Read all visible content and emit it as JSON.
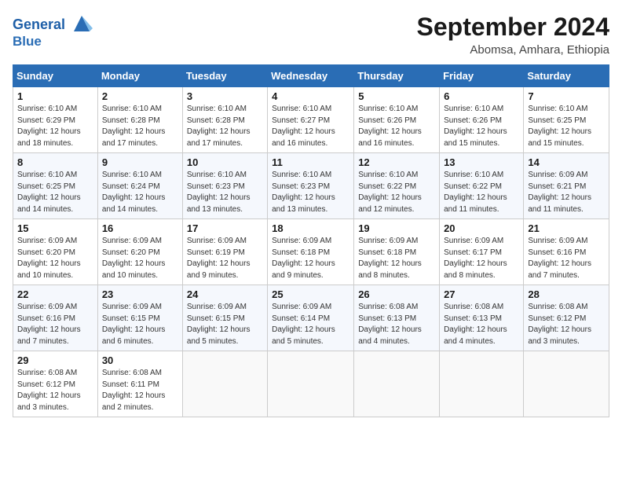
{
  "header": {
    "logo_line1": "General",
    "logo_line2": "Blue",
    "month": "September 2024",
    "location": "Abomsa, Amhara, Ethiopia"
  },
  "days_of_week": [
    "Sunday",
    "Monday",
    "Tuesday",
    "Wednesday",
    "Thursday",
    "Friday",
    "Saturday"
  ],
  "weeks": [
    [
      {
        "num": "1",
        "rise": "6:10 AM",
        "set": "6:29 PM",
        "hours": "12 hours and 18 minutes."
      },
      {
        "num": "2",
        "rise": "6:10 AM",
        "set": "6:28 PM",
        "hours": "12 hours and 17 minutes."
      },
      {
        "num": "3",
        "rise": "6:10 AM",
        "set": "6:28 PM",
        "hours": "12 hours and 17 minutes."
      },
      {
        "num": "4",
        "rise": "6:10 AM",
        "set": "6:27 PM",
        "hours": "12 hours and 16 minutes."
      },
      {
        "num": "5",
        "rise": "6:10 AM",
        "set": "6:26 PM",
        "hours": "12 hours and 16 minutes."
      },
      {
        "num": "6",
        "rise": "6:10 AM",
        "set": "6:26 PM",
        "hours": "12 hours and 15 minutes."
      },
      {
        "num": "7",
        "rise": "6:10 AM",
        "set": "6:25 PM",
        "hours": "12 hours and 15 minutes."
      }
    ],
    [
      {
        "num": "8",
        "rise": "6:10 AM",
        "set": "6:25 PM",
        "hours": "12 hours and 14 minutes."
      },
      {
        "num": "9",
        "rise": "6:10 AM",
        "set": "6:24 PM",
        "hours": "12 hours and 14 minutes."
      },
      {
        "num": "10",
        "rise": "6:10 AM",
        "set": "6:23 PM",
        "hours": "12 hours and 13 minutes."
      },
      {
        "num": "11",
        "rise": "6:10 AM",
        "set": "6:23 PM",
        "hours": "12 hours and 13 minutes."
      },
      {
        "num": "12",
        "rise": "6:10 AM",
        "set": "6:22 PM",
        "hours": "12 hours and 12 minutes."
      },
      {
        "num": "13",
        "rise": "6:10 AM",
        "set": "6:22 PM",
        "hours": "12 hours and 11 minutes."
      },
      {
        "num": "14",
        "rise": "6:09 AM",
        "set": "6:21 PM",
        "hours": "12 hours and 11 minutes."
      }
    ],
    [
      {
        "num": "15",
        "rise": "6:09 AM",
        "set": "6:20 PM",
        "hours": "12 hours and 10 minutes."
      },
      {
        "num": "16",
        "rise": "6:09 AM",
        "set": "6:20 PM",
        "hours": "12 hours and 10 minutes."
      },
      {
        "num": "17",
        "rise": "6:09 AM",
        "set": "6:19 PM",
        "hours": "12 hours and 9 minutes."
      },
      {
        "num": "18",
        "rise": "6:09 AM",
        "set": "6:18 PM",
        "hours": "12 hours and 9 minutes."
      },
      {
        "num": "19",
        "rise": "6:09 AM",
        "set": "6:18 PM",
        "hours": "12 hours and 8 minutes."
      },
      {
        "num": "20",
        "rise": "6:09 AM",
        "set": "6:17 PM",
        "hours": "12 hours and 8 minutes."
      },
      {
        "num": "21",
        "rise": "6:09 AM",
        "set": "6:16 PM",
        "hours": "12 hours and 7 minutes."
      }
    ],
    [
      {
        "num": "22",
        "rise": "6:09 AM",
        "set": "6:16 PM",
        "hours": "12 hours and 7 minutes."
      },
      {
        "num": "23",
        "rise": "6:09 AM",
        "set": "6:15 PM",
        "hours": "12 hours and 6 minutes."
      },
      {
        "num": "24",
        "rise": "6:09 AM",
        "set": "6:15 PM",
        "hours": "12 hours and 5 minutes."
      },
      {
        "num": "25",
        "rise": "6:09 AM",
        "set": "6:14 PM",
        "hours": "12 hours and 5 minutes."
      },
      {
        "num": "26",
        "rise": "6:08 AM",
        "set": "6:13 PM",
        "hours": "12 hours and 4 minutes."
      },
      {
        "num": "27",
        "rise": "6:08 AM",
        "set": "6:13 PM",
        "hours": "12 hours and 4 minutes."
      },
      {
        "num": "28",
        "rise": "6:08 AM",
        "set": "6:12 PM",
        "hours": "12 hours and 3 minutes."
      }
    ],
    [
      {
        "num": "29",
        "rise": "6:08 AM",
        "set": "6:12 PM",
        "hours": "12 hours and 3 minutes."
      },
      {
        "num": "30",
        "rise": "6:08 AM",
        "set": "6:11 PM",
        "hours": "12 hours and 2 minutes."
      },
      null,
      null,
      null,
      null,
      null
    ]
  ],
  "labels": {
    "sunrise": "Sunrise:",
    "sunset": "Sunset:",
    "daylight": "Daylight:"
  }
}
